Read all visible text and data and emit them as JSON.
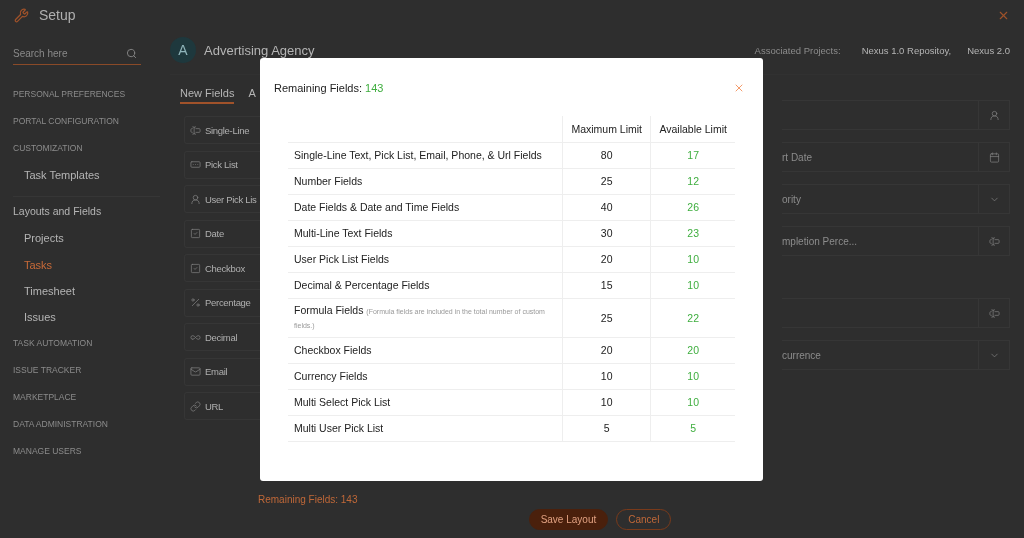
{
  "header": {
    "title": "Setup"
  },
  "sidebar": {
    "search_placeholder": "Search here",
    "sections": [
      {
        "label": "PERSONAL PREFERENCES",
        "kind": "heading"
      },
      {
        "label": "PORTAL CONFIGURATION",
        "kind": "heading"
      },
      {
        "label": "CUSTOMIZATION",
        "kind": "heading",
        "children": [
          {
            "label": "Task Templates",
            "selected": false
          }
        ]
      },
      {
        "label": "Layouts and Fields",
        "kind": "group",
        "children": [
          {
            "label": "Projects",
            "selected": false
          },
          {
            "label": "Tasks",
            "selected": true
          },
          {
            "label": "Timesheet",
            "selected": false
          },
          {
            "label": "Issues",
            "selected": false
          }
        ]
      },
      {
        "label": "TASK AUTOMATION",
        "kind": "heading"
      },
      {
        "label": "ISSUE TRACKER",
        "kind": "heading"
      },
      {
        "label": "MARKETPLACE",
        "kind": "heading"
      },
      {
        "label": "DATA ADMINISTRATION",
        "kind": "heading"
      },
      {
        "label": "MANAGE USERS",
        "kind": "heading"
      }
    ]
  },
  "organization": {
    "avatar": "A",
    "name": "Advertising Agency"
  },
  "associated_projects": {
    "label": "Associated Projects:",
    "projects": [
      "Nexus 1.0 Repositoy,",
      "Nexus 2.0"
    ]
  },
  "tabs": [
    {
      "label": "New Fields",
      "selected": true
    },
    {
      "label": "A",
      "selected": false
    }
  ],
  "palette": [
    {
      "label": "Single-Line",
      "kind": "text"
    },
    {
      "label": "Pick List",
      "kind": "picklist"
    },
    {
      "label": "User Pick Lis",
      "kind": "user"
    },
    {
      "label": "Date",
      "kind": "date"
    },
    {
      "label": "Checkbox",
      "kind": "checkbox"
    },
    {
      "label": "Percentage",
      "kind": "percent"
    },
    {
      "label": "Decimal",
      "kind": "decimal"
    },
    {
      "label": "Email",
      "kind": "email"
    },
    {
      "label": "URL",
      "kind": "url"
    }
  ],
  "layout_sections": [
    {
      "fields": [
        {
          "kind": "user"
        },
        {
          "label": "rt Date",
          "kind": "calendar"
        },
        {
          "label": "ority",
          "kind": "dropdown"
        },
        {
          "label": "mpletion Perce...",
          "kind": "text"
        }
      ]
    },
    {
      "fields": [
        {
          "kind": "text"
        },
        {
          "label": "currence",
          "kind": "dropdown"
        }
      ]
    }
  ],
  "footer": {
    "remaining": "Remaining Fields: 143",
    "buttons": [
      {
        "label": "Save Layout",
        "kind": "primary"
      },
      {
        "label": "Cancel",
        "kind": "secondary"
      }
    ]
  },
  "modal": {
    "title": "Remaining Fields:",
    "count": "143",
    "columns": [
      "Maximum Limit",
      "Available Limit"
    ],
    "rows": [
      {
        "name": "Single-Line Text, Pick List, Email, Phone, & Url Fields",
        "max": "80",
        "available": "17"
      },
      {
        "name": "Number Fields",
        "max": "25",
        "available": "12"
      },
      {
        "name": "Date Fields & Date and Time Fields",
        "max": "40",
        "available": "26"
      },
      {
        "name": "Multi-Line Text Fields",
        "max": "30",
        "available": "23"
      },
      {
        "name": "User Pick List Fields",
        "max": "20",
        "available": "10"
      },
      {
        "name": "Decimal & Percentage Fields",
        "max": "15",
        "available": "10"
      },
      {
        "name": "Formula Fields",
        "note": "(Formula fields are included in the total number of custom fields.)",
        "max": "25",
        "available": "22"
      },
      {
        "name": "Checkbox Fields",
        "max": "20",
        "available": "20"
      },
      {
        "name": "Currency Fields",
        "max": "10",
        "available": "10"
      },
      {
        "name": "Multi Select Pick List",
        "max": "10",
        "available": "10"
      },
      {
        "name": "Multi User Pick List",
        "max": "5",
        "available": "5"
      }
    ]
  }
}
